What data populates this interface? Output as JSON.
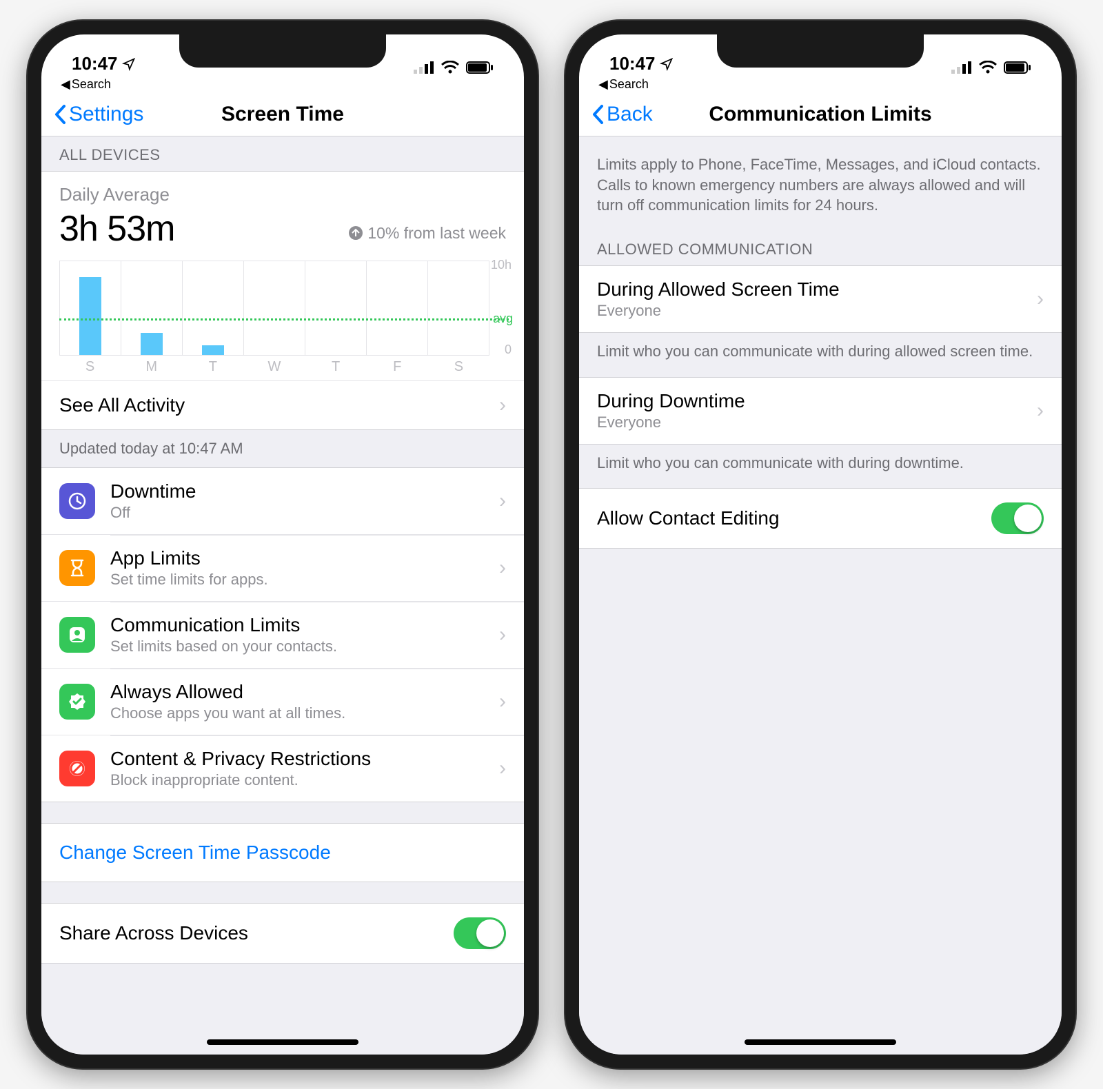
{
  "status": {
    "time": "10:47",
    "back_app": "Search"
  },
  "phone1": {
    "nav_back": "Settings",
    "nav_title": "Screen Time",
    "section_all": "ALL DEVICES",
    "daily_label": "Daily Average",
    "daily_value": "3h 53m",
    "daily_delta": "10% from last week",
    "see_all": "See All Activity",
    "updated": "Updated today at 10:47 AM",
    "rows": {
      "downtime": {
        "title": "Downtime",
        "sub": "Off"
      },
      "applimits": {
        "title": "App Limits",
        "sub": "Set time limits for apps."
      },
      "comm": {
        "title": "Communication Limits",
        "sub": "Set limits based on your contacts."
      },
      "always": {
        "title": "Always Allowed",
        "sub": "Choose apps you want at all times."
      },
      "content": {
        "title": "Content & Privacy Restrictions",
        "sub": "Block inappropriate content."
      }
    },
    "change_passcode": "Change Screen Time Passcode",
    "share": "Share Across Devices"
  },
  "phone2": {
    "nav_back": "Back",
    "nav_title": "Communication Limits",
    "intro": "Limits apply to Phone, FaceTime, Messages, and iCloud contacts. Calls to known emergency numbers are always allowed and will turn off communication limits for 24 hours.",
    "section_allowed": "ALLOWED COMMUNICATION",
    "during_allowed": {
      "title": "During Allowed Screen Time",
      "sub": "Everyone"
    },
    "during_allowed_footer": "Limit who you can communicate with during allowed screen time.",
    "during_downtime": {
      "title": "During Downtime",
      "sub": "Everyone"
    },
    "during_downtime_footer": "Limit who you can communicate with during downtime.",
    "allow_contact": "Allow Contact Editing"
  },
  "chart_data": {
    "type": "bar",
    "categories": [
      "S",
      "M",
      "T",
      "W",
      "T",
      "F",
      "S"
    ],
    "values": [
      8.2,
      2.3,
      1.0,
      0,
      0,
      0,
      0
    ],
    "avg": 3.88,
    "ylim": [
      0,
      10
    ],
    "ylabel_top": "10h",
    "ylabel_bottom": "0",
    "avg_label": "avg"
  }
}
